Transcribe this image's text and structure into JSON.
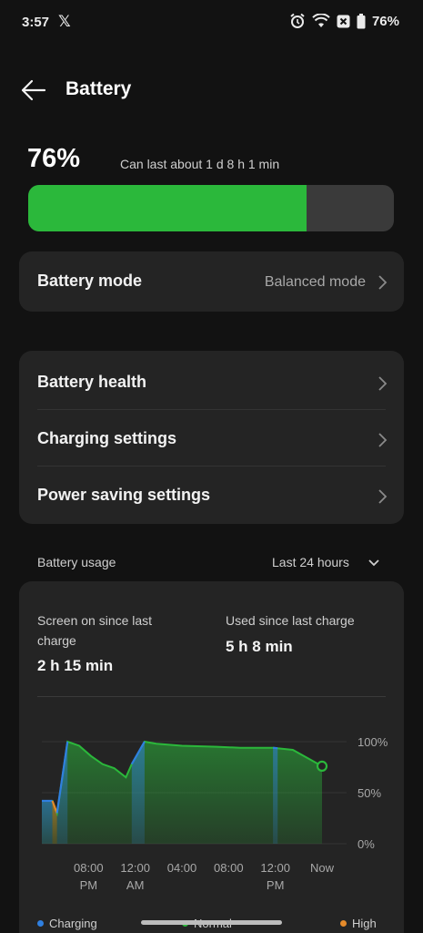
{
  "status_bar": {
    "time": "3:57",
    "x_glyph": "𝕏",
    "battery_percent": "76%",
    "icons": [
      "x-logo-icon",
      "alarm-icon",
      "wifi-icon",
      "close-box-icon",
      "battery-icon"
    ]
  },
  "header": {
    "title": "Battery",
    "back_icon": "arrow-left-icon"
  },
  "battery": {
    "percent": "76%",
    "estimate": "Can last about 1 d 8 h 1 min",
    "level": 0.76,
    "fill_color": "#2bb83b"
  },
  "mode_card": {
    "label": "Battery mode",
    "value": "Balanced mode"
  },
  "settings": {
    "items": [
      {
        "label": "Battery health"
      },
      {
        "label": "Charging settings"
      },
      {
        "label": "Power saving settings"
      }
    ]
  },
  "usage": {
    "section_label": "Battery usage",
    "range": "Last 24 hours",
    "screen_on_label": "Screen on since last charge",
    "screen_on_value": "2 h 15 min",
    "used_label": "Used since last charge",
    "used_value": "5 h 8 min"
  },
  "chart_data": {
    "type": "area",
    "y_ticks": [
      "100%",
      "50%",
      "0%"
    ],
    "ylim": [
      0,
      100
    ],
    "x_ticks": [
      {
        "label": "08:00\nPM",
        "t": 4
      },
      {
        "label": "12:00\nAM",
        "t": 8
      },
      {
        "label": "04:00",
        "t": 12
      },
      {
        "label": "08:00",
        "t": 16
      },
      {
        "label": "12:00\nPM",
        "t": 20
      },
      {
        "label": "Now",
        "t": 24
      }
    ],
    "xlim": [
      0,
      24
    ],
    "points": [
      [
        0,
        42
      ],
      [
        0.9,
        42
      ],
      [
        1.3,
        30
      ],
      [
        2.2,
        100
      ],
      [
        3.2,
        96
      ],
      [
        4.2,
        86
      ],
      [
        5.2,
        78
      ],
      [
        6.2,
        74
      ],
      [
        7.2,
        65
      ],
      [
        7.7,
        78
      ],
      [
        8.8,
        100
      ],
      [
        9.8,
        98
      ],
      [
        12,
        96
      ],
      [
        15,
        95
      ],
      [
        17,
        94
      ],
      [
        19.8,
        94
      ],
      [
        21.5,
        92
      ],
      [
        24,
        76
      ]
    ],
    "segments": [
      {
        "from": 0,
        "to": 0.9,
        "status": "charging"
      },
      {
        "from": 0.9,
        "to": 1.3,
        "status": "high"
      },
      {
        "from": 1.3,
        "to": 2.2,
        "status": "charging"
      },
      {
        "from": 7.7,
        "to": 8.8,
        "status": "charging"
      },
      {
        "from": 19.8,
        "to": 20.2,
        "status": "charging"
      }
    ],
    "legend": [
      {
        "name": "Charging",
        "color": "#2f7fe0"
      },
      {
        "name": "Normal",
        "color": "#2bb83b"
      },
      {
        "name": "High",
        "color": "#e48a2a"
      }
    ],
    "grid": true
  }
}
